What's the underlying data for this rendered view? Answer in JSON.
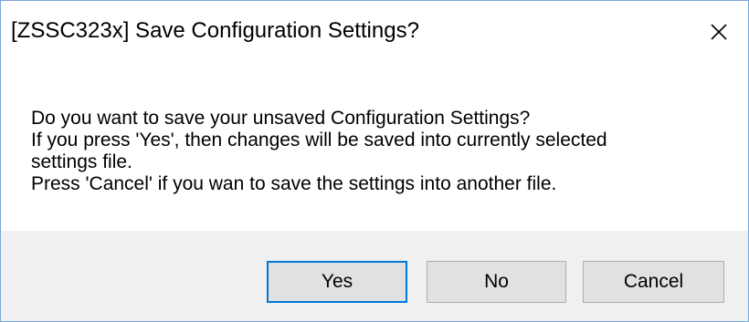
{
  "window": {
    "title": "[ZSSC323x] Save Configuration Settings?",
    "close_icon": "close-icon"
  },
  "message": {
    "lines": [
      "Do you want to save your unsaved Configuration Settings?",
      "If you press 'Yes', then changes will be saved into currently selected",
      "settings file.",
      "Press 'Cancel' if you wan to save the settings into another file."
    ]
  },
  "buttons": {
    "yes_label": "Yes",
    "no_label": "No",
    "cancel_label": "Cancel"
  },
  "colors": {
    "border": "#7aa7d6",
    "default_button_border": "#0078d7",
    "button_face": "#e1e1e1",
    "button_bar": "#f0f0f0"
  }
}
